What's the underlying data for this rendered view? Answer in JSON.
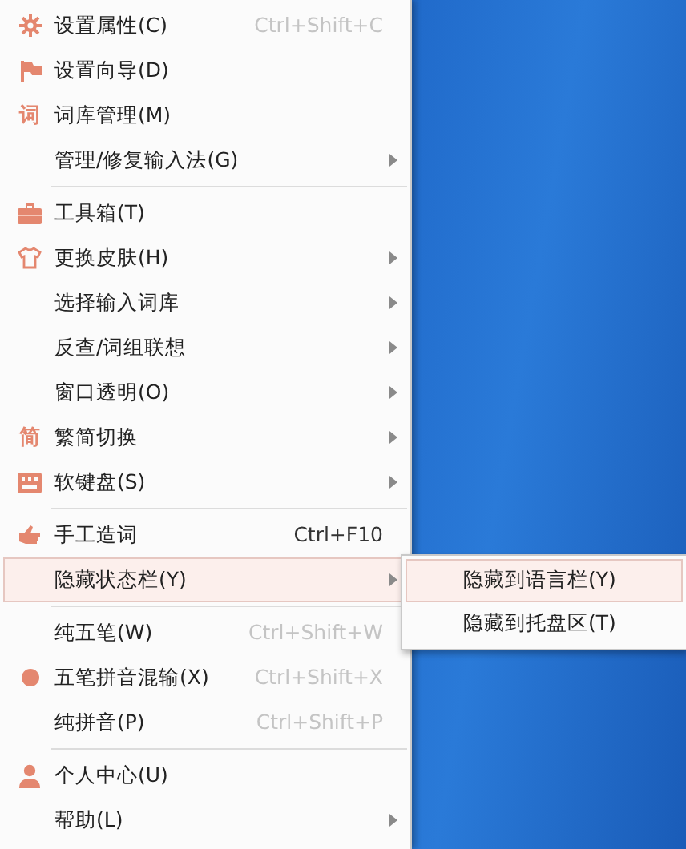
{
  "menu": {
    "items": [
      {
        "kind": "item",
        "label": "设置属性(C)",
        "shortcut": {
          "text": "Ctrl+Shift+C",
          "dimmed": true
        },
        "submenu": false,
        "selected": false
      },
      {
        "kind": "item",
        "label": "设置向导(D)",
        "submenu": false,
        "selected": false
      },
      {
        "kind": "item",
        "label": "词库管理(M)",
        "glyph": "词",
        "submenu": false,
        "selected": false
      },
      {
        "kind": "item",
        "label": "管理/修复输入法(G)",
        "submenu": true,
        "selected": false
      },
      {
        "kind": "separator"
      },
      {
        "kind": "item",
        "label": "工具箱(T)",
        "submenu": false,
        "selected": false
      },
      {
        "kind": "item",
        "label": "更换皮肤(H)",
        "submenu": true,
        "selected": false
      },
      {
        "kind": "item",
        "label": "选择输入词库",
        "submenu": true,
        "selected": false
      },
      {
        "kind": "item",
        "label": "反查/词组联想",
        "submenu": true,
        "selected": false
      },
      {
        "kind": "item",
        "label": "窗口透明(O)",
        "submenu": true,
        "selected": false
      },
      {
        "kind": "item",
        "label": "繁简切换",
        "glyph": "简",
        "submenu": true,
        "selected": false
      },
      {
        "kind": "item",
        "label": "软键盘(S)",
        "submenu": true,
        "selected": false
      },
      {
        "kind": "separator"
      },
      {
        "kind": "item",
        "label": "手工造词",
        "shortcut": {
          "text": "Ctrl+F10",
          "dimmed": false
        },
        "submenu": false,
        "selected": false
      },
      {
        "kind": "item",
        "label": "隐藏状态栏(Y)",
        "submenu": true,
        "selected": true
      },
      {
        "kind": "separator"
      },
      {
        "kind": "item",
        "label": "纯五笔(W)",
        "shortcut": {
          "text": "Ctrl+Shift+W",
          "dimmed": true
        },
        "submenu": false,
        "selected": false
      },
      {
        "kind": "item",
        "label": "五笔拼音混输(X)",
        "shortcut": {
          "text": "Ctrl+Shift+X",
          "dimmed": true
        },
        "submenu": false,
        "selected": false
      },
      {
        "kind": "item",
        "label": "纯拼音(P)",
        "shortcut": {
          "text": "Ctrl+Shift+P",
          "dimmed": true
        },
        "submenu": false,
        "selected": false
      },
      {
        "kind": "separator"
      },
      {
        "kind": "item",
        "label": "个人中心(U)",
        "submenu": false,
        "selected": false
      },
      {
        "kind": "item",
        "label": "帮助(L)",
        "submenu": true,
        "selected": false
      }
    ]
  },
  "submenu": {
    "items": [
      {
        "label": "隐藏到语言栏(Y)",
        "selected": true
      },
      {
        "label": "隐藏到托盘区(T)",
        "selected": false
      }
    ]
  }
}
